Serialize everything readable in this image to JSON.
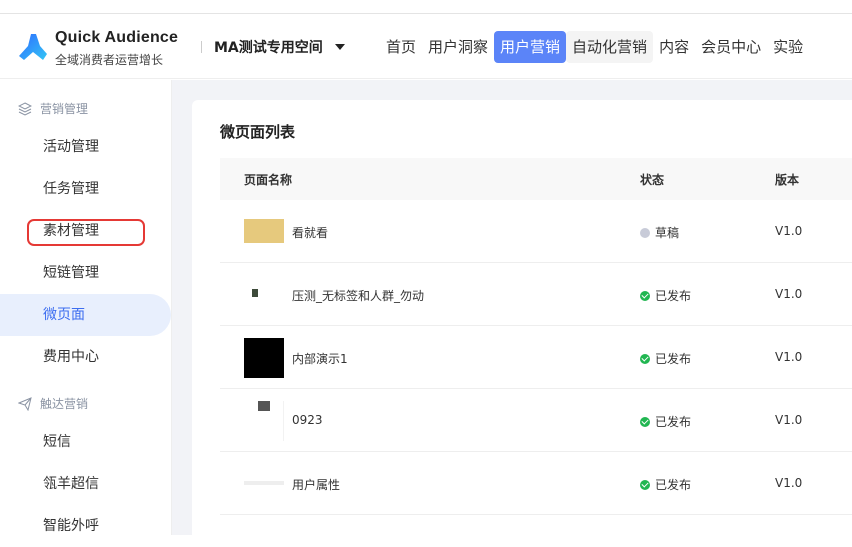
{
  "header": {
    "brand": "Quick Audience",
    "brand_sub": "全域消费者运营增长",
    "workspace": "MA测试专用空间",
    "nav": [
      {
        "label": "首页"
      },
      {
        "label": "用户洞察"
      },
      {
        "label": "用户营销"
      },
      {
        "label": "自动化营销"
      },
      {
        "label": "内容"
      },
      {
        "label": "会员中心"
      },
      {
        "label": "实验"
      }
    ]
  },
  "sidebar": {
    "group1": "营销管理",
    "items1": [
      {
        "label": "活动管理"
      },
      {
        "label": "任务管理"
      },
      {
        "label": "素材管理"
      },
      {
        "label": "短链管理"
      },
      {
        "label": "微页面"
      },
      {
        "label": "费用中心"
      }
    ],
    "group2": "触达营销",
    "items2": [
      {
        "label": "短信"
      },
      {
        "label": "瓴羊超信"
      },
      {
        "label": "智能外呼"
      }
    ]
  },
  "main": {
    "title": "微页面列表",
    "columns": {
      "name": "页面名称",
      "status": "状态",
      "version": "版本"
    },
    "rows": [
      {
        "name": "看就看",
        "status": "草稿",
        "version": "V1.0"
      },
      {
        "name": "压测_无标签和人群_勿动",
        "status": "已发布",
        "version": "V1.0"
      },
      {
        "name": "内部演示1",
        "status": "已发布",
        "version": "V1.0"
      },
      {
        "name": "0923",
        "status": "已发布",
        "version": "V1.0"
      },
      {
        "name": "用户属性",
        "status": "已发布",
        "version": "V1.0"
      }
    ]
  },
  "colors": {
    "accent": "#5b84f8",
    "published": "#21b651",
    "draft": "#c8cbd8",
    "highlight": "#e53935"
  }
}
